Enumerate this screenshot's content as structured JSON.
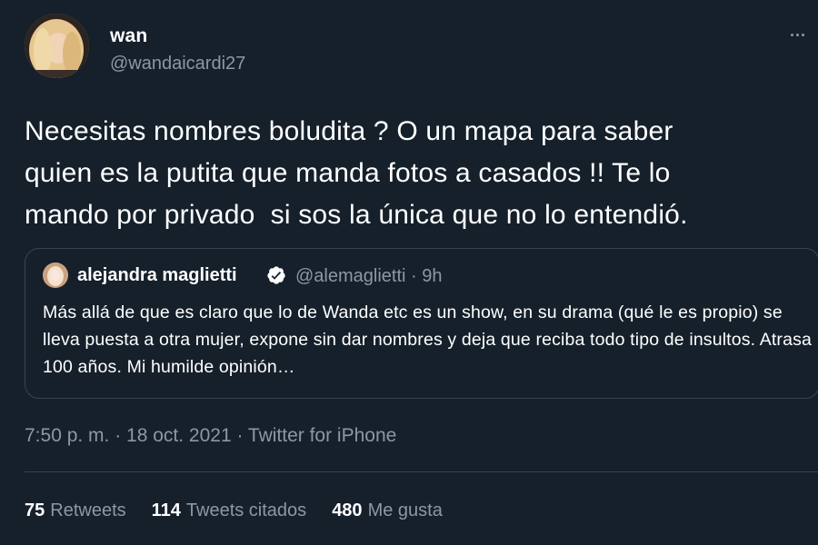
{
  "author": {
    "display_name": "wan",
    "handle": "@wandaicardi27"
  },
  "tweet_text": "Necesitas nombres boludita ? O un mapa para saber\nquien es la putita que manda fotos a casados !! Te lo\nmando por privado  si sos la única que no lo entendió.",
  "quoted_tweet": {
    "display_name": "alejandra maglietti",
    "meta": "@alemaglietti · 9h",
    "text": "Más allá de que es claro que lo de Wanda etc es un show, en su drama (qué le es propio) se lleva puesta a otra mujer, expone sin dar nombres y deja que reciba todo tipo de insultos. Atrasa 100 años. Mi humilde opinión…"
  },
  "timestamp": "7:50 p. m. · 18 oct. 2021 · Twitter for iPhone",
  "stats": {
    "retweets_count": "75",
    "retweets_label": "Retweets",
    "quotes_count": "114",
    "quotes_label": "Tweets citados",
    "likes_count": "480",
    "likes_label": "Me gusta"
  },
  "colors": {
    "background": "#15202b",
    "text_primary": "#ffffff",
    "text_secondary": "#8b98a5",
    "border": "#38444d",
    "verified": "#1d9bf0"
  },
  "icons": {
    "verified": "verified-badge-icon",
    "more": "more-dots-icon"
  }
}
